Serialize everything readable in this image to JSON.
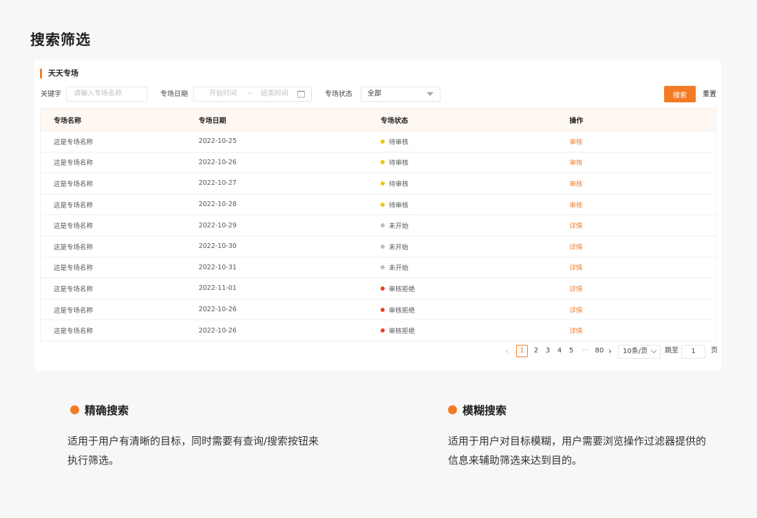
{
  "page_title": "搜索筛选",
  "card_title": "天天专场",
  "filters": {
    "keyword_label": "关键字",
    "keyword_placeholder": "请输入专场名称",
    "date_label": "专场日期",
    "date_start_placeholder": "开始时间",
    "date_separator": "~",
    "date_end_placeholder": "结束时间",
    "status_label": "专场状态",
    "status_value": "全部",
    "search_button": "搜索",
    "reset_button": "重置"
  },
  "table": {
    "columns": [
      "专场名称",
      "专场日期",
      "专场状态",
      "操作"
    ],
    "rows": [
      {
        "name": "这是专场名称",
        "date": "2022-10-25",
        "status": "待审核",
        "status_color": "#f5c400",
        "action": "审核"
      },
      {
        "name": "这是专场名称",
        "date": "2022-10-26",
        "status": "待审核",
        "status_color": "#f5c400",
        "action": "审核"
      },
      {
        "name": "这是专场名称",
        "date": "2022-10-27",
        "status": "待审核",
        "status_color": "#f5c400",
        "action": "审核"
      },
      {
        "name": "这是专场名称",
        "date": "2022-10-28",
        "status": "待审核",
        "status_color": "#f5c400",
        "action": "审核"
      },
      {
        "name": "这是专场名称",
        "date": "2022-10-29",
        "status": "未开始",
        "status_color": "#bdbdbd",
        "action": "详情"
      },
      {
        "name": "这是专场名称",
        "date": "2022-10-30",
        "status": "未开始",
        "status_color": "#bdbdbd",
        "action": "详情"
      },
      {
        "name": "这是专场名称",
        "date": "2022-10-31",
        "status": "未开始",
        "status_color": "#bdbdbd",
        "action": "详情"
      },
      {
        "name": "这是专场名称",
        "date": "2022-11-01",
        "status": "审核拒绝",
        "status_color": "#e8431b",
        "action": "详情"
      },
      {
        "name": "这是专场名称",
        "date": "2022-10-26",
        "status": "审核拒绝",
        "status_color": "#e8431b",
        "action": "详情"
      },
      {
        "name": "这是专场名称",
        "date": "2022-10-26",
        "status": "审核拒绝",
        "status_color": "#e8431b",
        "action": "详情"
      }
    ]
  },
  "pagination": {
    "current": "1",
    "pages": [
      "2",
      "3",
      "4",
      "5"
    ],
    "ellipsis": "···",
    "last": "80",
    "page_size": "10条/页",
    "jump_label": "跳至",
    "jump_value": "1",
    "page_suffix": "页"
  },
  "features": [
    {
      "title": "精确搜索",
      "desc": "适用于用户有清晰的目标，同时需要有查询/搜索按钮来执行筛选。"
    },
    {
      "title": "模糊搜索",
      "desc": "适用于用户对目标模糊，用户需要浏览操作过滤器提供的信息来辅助筛选来达到目的。"
    }
  ],
  "accent_color": "#f37b26"
}
